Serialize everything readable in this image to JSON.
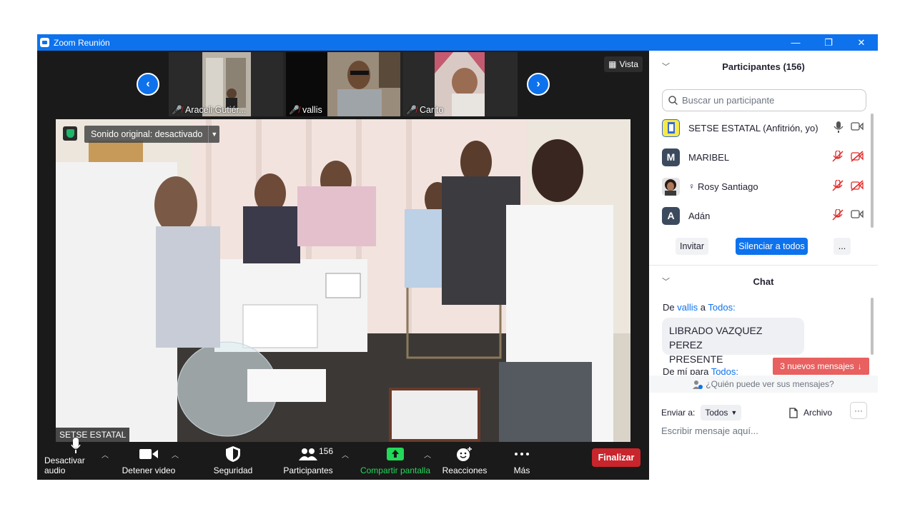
{
  "window": {
    "title": "Zoom Reunión",
    "minimize": "—",
    "restore": "❐",
    "close": "✕"
  },
  "gallery": {
    "thumbnails": [
      {
        "name": "Araceli Gutiér...",
        "muted": true
      },
      {
        "name": "vallis",
        "muted": true
      },
      {
        "name": "Carito",
        "muted": true
      }
    ],
    "prev": "‹",
    "next": "›",
    "view_label": "Vista"
  },
  "main_video": {
    "sound_label": "Sonido original: desactivado",
    "speaker_name": "SETSE ESTATAL"
  },
  "toolbar": {
    "mute_label": "Desactivar audio",
    "video_label": "Detener video",
    "security_label": "Seguridad",
    "participants_label": "Participantes",
    "participants_count": "156",
    "share_label": "Compartir pantalla",
    "reactions_label": "Reacciones",
    "more_label": "Más",
    "end_label": "Finalizar"
  },
  "participants": {
    "header": "Participantes (156)",
    "search_placeholder": "Buscar un participante",
    "items": [
      {
        "name": "SETSE ESTATAL (Anfitrión, yo)",
        "avatar": "",
        "mic": "on",
        "video": "on"
      },
      {
        "name": "MARIBEL",
        "avatar": "M",
        "mic": "off",
        "video": "off"
      },
      {
        "name": "Rosy Santiago",
        "avatar": "",
        "mic": "off",
        "video": "off"
      },
      {
        "name": "Adán",
        "avatar": "A",
        "mic": "off",
        "video": "on"
      }
    ],
    "invite_label": "Invitar",
    "mute_all_label": "Silenciar a todos",
    "more_label": "..."
  },
  "chat": {
    "header": "Chat",
    "msg1": {
      "from_prefix": "De",
      "from": "vallis",
      "to_prefix": "a",
      "to": "Todos:"
    },
    "msg1_text_line1": "LIBRADO VAZQUEZ PEREZ",
    "msg1_text_line2": "PRESENTE",
    "msg2": {
      "from_prefix": "De mí para",
      "to": "Todos:"
    },
    "new_messages": "3 nuevos mensajes",
    "who_can_see": "¿Quién puede ver sus mensajes?",
    "send_to_label": "Enviar a:",
    "send_to_value": "Todos",
    "file_label": "Archivo",
    "input_placeholder": "Escribir mensaje aquí..."
  }
}
